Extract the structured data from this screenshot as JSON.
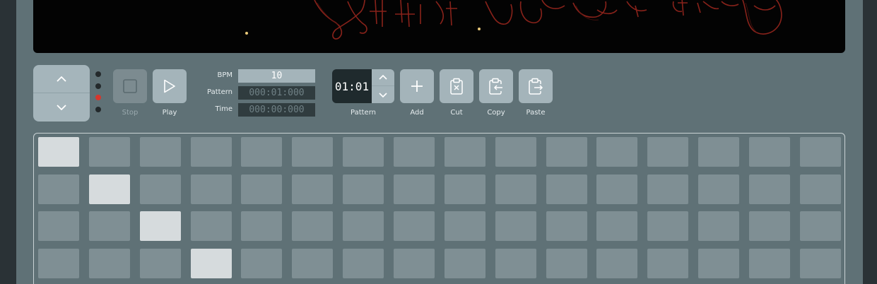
{
  "transport": {
    "stop_label": "Stop",
    "play_label": "Play"
  },
  "fields": {
    "bpm_label": "BPM",
    "bpm_value": "10",
    "pattern_label": "Pattern",
    "pattern_value": "000:01:000",
    "time_label": "Time",
    "time_value": "000:00:000"
  },
  "pattern": {
    "value": "01:01",
    "label": "Pattern"
  },
  "edit": {
    "add_label": "Add",
    "cut_label": "Cut",
    "copy_label": "Copy",
    "paste_label": "Paste"
  },
  "octave_leds": {
    "count": 4,
    "active_index": 2,
    "active_color": "#d7362c"
  },
  "step_grid": {
    "rows": 4,
    "columns": 16,
    "active": [
      [
        0,
        0
      ],
      [
        1,
        1
      ],
      [
        2,
        2
      ],
      [
        3,
        3
      ]
    ]
  },
  "colors": {
    "panel": "#5f7176",
    "button": "#a4b4ba",
    "active_pad": "#d6dbdd",
    "display_glyphs": "#c0392b"
  }
}
